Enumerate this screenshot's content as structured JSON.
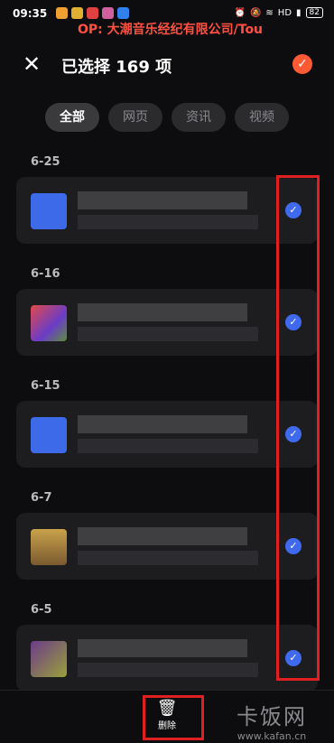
{
  "status_bar": {
    "time": "09:35",
    "ticker": "OP: 大潮音乐经纪有限公司/Tou",
    "battery": "82"
  },
  "header": {
    "title": "已选择 169 项",
    "close_icon": "close-icon",
    "select_all_icon": "check-circle-icon"
  },
  "tabs": [
    {
      "label": "全部",
      "active": true
    },
    {
      "label": "网页",
      "active": false
    },
    {
      "label": "资讯",
      "active": false
    },
    {
      "label": "视频",
      "active": false
    }
  ],
  "groups": [
    {
      "date": "6-25",
      "selected": true
    },
    {
      "date": "6-16",
      "selected": true
    },
    {
      "date": "6-15",
      "selected": true
    },
    {
      "date": "6-7",
      "selected": true
    },
    {
      "date": "6-5",
      "selected": true
    }
  ],
  "bottom_bar": {
    "delete_label": "删除",
    "delete_icon": "trash-icon"
  },
  "watermark": {
    "brand": "卡饭网",
    "url": "www.kafan.cn"
  },
  "colors": {
    "accent": "#ff5a33",
    "check": "#3f6af0",
    "highlight_frame": "#e02020"
  }
}
